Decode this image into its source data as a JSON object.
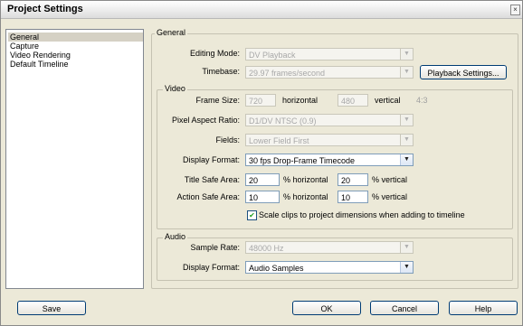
{
  "window": {
    "title": "Project Settings"
  },
  "sidebar": {
    "items": [
      {
        "label": "General",
        "selected": true
      },
      {
        "label": "Capture",
        "selected": false
      },
      {
        "label": "Video Rendering",
        "selected": false
      },
      {
        "label": "Default Timeline",
        "selected": false
      }
    ]
  },
  "general": {
    "group_label": "General",
    "editing_mode": {
      "label": "Editing Mode:",
      "value": "DV Playback"
    },
    "timebase": {
      "label": "Timebase:",
      "value": "29.97 frames/second"
    },
    "playback_settings_label": "Playback Settings..."
  },
  "video": {
    "group_label": "Video",
    "frame_size": {
      "label": "Frame Size:",
      "width": "720",
      "width_suffix": "horizontal",
      "height": "480",
      "height_suffix": "vertical",
      "ratio": "4:3"
    },
    "pixel_aspect_ratio": {
      "label": "Pixel Aspect Ratio:",
      "value": "D1/DV NTSC (0.9)"
    },
    "fields": {
      "label": "Fields:",
      "value": "Lower Field First"
    },
    "display_format": {
      "label": "Display Format:",
      "value": "30 fps Drop-Frame Timecode"
    },
    "title_safe": {
      "label": "Title Safe Area:",
      "horizontal": "20",
      "horizontal_suffix": "% horizontal",
      "vertical": "20",
      "vertical_suffix": "% vertical"
    },
    "action_safe": {
      "label": "Action Safe Area:",
      "horizontal": "10",
      "horizontal_suffix": "% horizontal",
      "vertical": "10",
      "vertical_suffix": "% vertical"
    },
    "scale_clips": {
      "label": "Scale clips to project dimensions when adding to timeline",
      "checked": true
    }
  },
  "audio": {
    "group_label": "Audio",
    "sample_rate": {
      "label": "Sample Rate:",
      "value": "48000 Hz"
    },
    "display_format": {
      "label": "Display Format:",
      "value": "Audio Samples"
    }
  },
  "buttons": {
    "save": "Save",
    "ok": "OK",
    "cancel": "Cancel",
    "help": "Help"
  },
  "icons": {
    "dropdown": "chevron-down-icon",
    "check": "check-icon",
    "close": "close-icon"
  },
  "colors": {
    "window_bg": "#ece9d8",
    "field_border": "#7f9db9",
    "selection": "#d5d1c4",
    "disabled_text": "#a0a0a0",
    "button_border": "#003c74"
  }
}
